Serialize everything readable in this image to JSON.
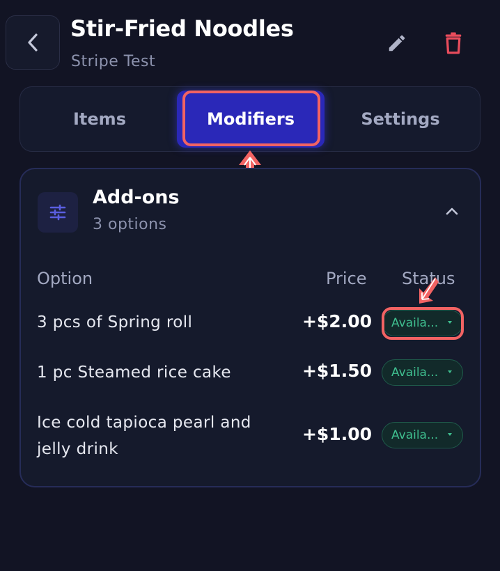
{
  "header": {
    "title": "Stir-Fried Noodles",
    "subtitle": "Stripe Test",
    "back_icon": "chevron-left-icon",
    "edit_icon": "pencil-icon",
    "delete_icon": "trash-icon"
  },
  "tabs": [
    {
      "label": "Items",
      "active": false
    },
    {
      "label": "Modifiers",
      "active": true
    },
    {
      "label": "Settings",
      "active": false
    }
  ],
  "modifier_group": {
    "title": "Add-ons",
    "count_label": "3 options",
    "icon": "sliders-icon",
    "collapse_icon": "chevron-up-icon",
    "columns": {
      "option": "Option",
      "price": "Price",
      "status": "Status"
    },
    "options": [
      {
        "name": "3 pcs of Spring roll",
        "price": "+$2.00",
        "status": "Availa..."
      },
      {
        "name": "1 pc Steamed rice cake",
        "price": "+$1.50",
        "status": "Availa..."
      },
      {
        "name": "Ice cold tapioca pearl and jelly drink",
        "price": "+$1.00",
        "status": "Availa..."
      }
    ]
  },
  "annotations": {
    "highlight_color": "#f26363",
    "highlighted": [
      "Modifiers tab",
      "first status dropdown"
    ]
  },
  "colors": {
    "background": "#121424",
    "accent": "#2a28b8",
    "delete": "#e84c5c",
    "status_green": "#3fbf8f"
  }
}
